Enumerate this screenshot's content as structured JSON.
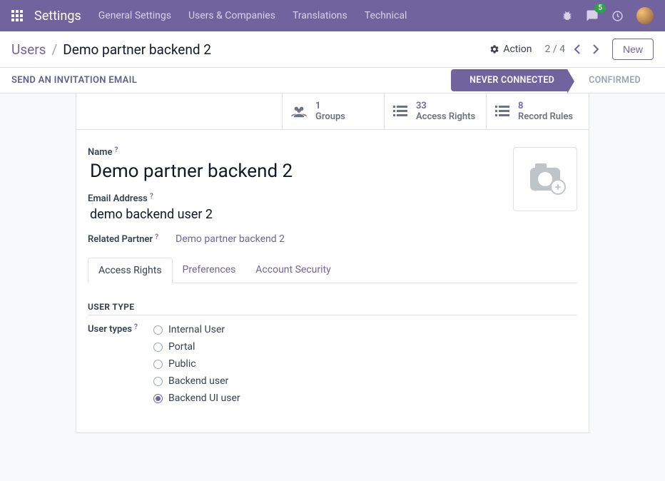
{
  "navbar": {
    "brand": "Settings",
    "menu": [
      "General Settings",
      "Users & Companies",
      "Translations",
      "Technical"
    ],
    "badge_count": "5"
  },
  "breadcrumb": {
    "parent": "Users",
    "current": "Demo partner backend 2"
  },
  "controls": {
    "action_label": "Action",
    "pager_current": "2",
    "pager_total": "4",
    "new_label": "New"
  },
  "status": {
    "invite": "SEND AN INVITATION EMAIL",
    "step_active": "NEVER CONNECTED",
    "step_inactive": "CONFIRMED"
  },
  "stats": [
    {
      "value": "1",
      "label": "Groups"
    },
    {
      "value": "33",
      "label": "Access Rights"
    },
    {
      "value": "8",
      "label": "Record Rules"
    }
  ],
  "fields": {
    "name_label": "Name",
    "name_value": "Demo partner backend 2",
    "email_label": "Email Address",
    "email_value": "demo backend user 2",
    "related_label": "Related Partner",
    "related_value": "Demo partner backend 2"
  },
  "tabs": [
    "Access Rights",
    "Preferences",
    "Account Security"
  ],
  "section": {
    "user_type_heading": "USER TYPE",
    "user_types_label": "User types"
  },
  "user_types": [
    {
      "label": "Internal User",
      "checked": false
    },
    {
      "label": "Portal",
      "checked": false
    },
    {
      "label": "Public",
      "checked": false
    },
    {
      "label": "Backend user",
      "checked": false
    },
    {
      "label": "Backend UI user",
      "checked": true
    }
  ],
  "help_symbol": "?"
}
